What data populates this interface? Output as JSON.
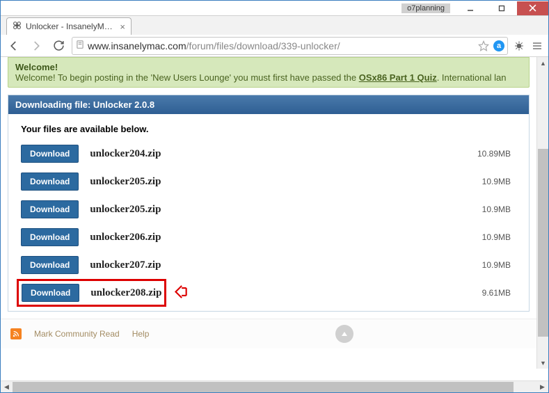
{
  "titlebar": {
    "tag": "o7planning"
  },
  "tab": {
    "title": "Unlocker - InsanelyMac Fo"
  },
  "url": {
    "host": "www.insanelymac.com",
    "path": "/forum/files/download/339-unlocker/"
  },
  "welcome": {
    "heading": "Welcome!",
    "pre": "Welcome! To begin posting in the 'New Users Lounge' you must first have passed the ",
    "link": "OSx86 Part 1 Quiz",
    "post": ". International lan"
  },
  "panel": {
    "title": "Downloading file: Unlocker 2.0.8",
    "avail": "Your files are available below."
  },
  "button_label": "Download",
  "files": [
    {
      "name": "unlocker204.zip",
      "size": "10.89MB"
    },
    {
      "name": "unlocker205.zip",
      "size": "10.9MB"
    },
    {
      "name": "unlocker205.zip",
      "size": "10.9MB"
    },
    {
      "name": "unlocker206.zip",
      "size": "10.9MB"
    },
    {
      "name": "unlocker207.zip",
      "size": "10.9MB"
    },
    {
      "name": "unlocker208.zip",
      "size": "9.61MB"
    }
  ],
  "footer": {
    "mark": "Mark Community Read",
    "help": "Help"
  }
}
